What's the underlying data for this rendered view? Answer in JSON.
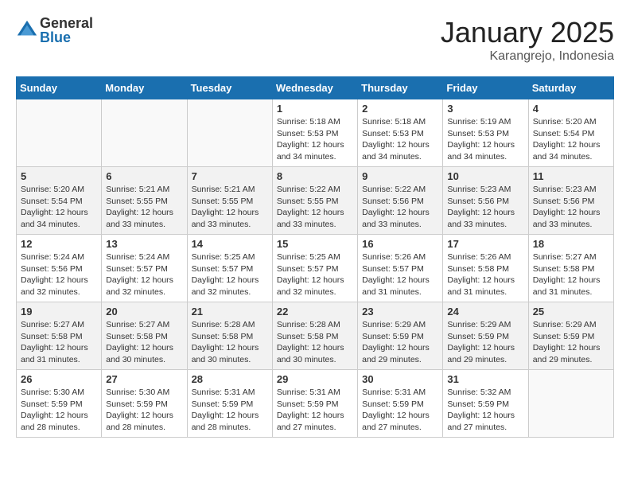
{
  "logo": {
    "general": "General",
    "blue": "Blue"
  },
  "title": "January 2025",
  "location": "Karangrejo, Indonesia",
  "weekdays": [
    "Sunday",
    "Monday",
    "Tuesday",
    "Wednesday",
    "Thursday",
    "Friday",
    "Saturday"
  ],
  "weeks": [
    [
      {
        "day": "",
        "info": ""
      },
      {
        "day": "",
        "info": ""
      },
      {
        "day": "",
        "info": ""
      },
      {
        "day": "1",
        "info": "Sunrise: 5:18 AM\nSunset: 5:53 PM\nDaylight: 12 hours\nand 34 minutes."
      },
      {
        "day": "2",
        "info": "Sunrise: 5:18 AM\nSunset: 5:53 PM\nDaylight: 12 hours\nand 34 minutes."
      },
      {
        "day": "3",
        "info": "Sunrise: 5:19 AM\nSunset: 5:53 PM\nDaylight: 12 hours\nand 34 minutes."
      },
      {
        "day": "4",
        "info": "Sunrise: 5:20 AM\nSunset: 5:54 PM\nDaylight: 12 hours\nand 34 minutes."
      }
    ],
    [
      {
        "day": "5",
        "info": "Sunrise: 5:20 AM\nSunset: 5:54 PM\nDaylight: 12 hours\nand 34 minutes."
      },
      {
        "day": "6",
        "info": "Sunrise: 5:21 AM\nSunset: 5:55 PM\nDaylight: 12 hours\nand 33 minutes."
      },
      {
        "day": "7",
        "info": "Sunrise: 5:21 AM\nSunset: 5:55 PM\nDaylight: 12 hours\nand 33 minutes."
      },
      {
        "day": "8",
        "info": "Sunrise: 5:22 AM\nSunset: 5:55 PM\nDaylight: 12 hours\nand 33 minutes."
      },
      {
        "day": "9",
        "info": "Sunrise: 5:22 AM\nSunset: 5:56 PM\nDaylight: 12 hours\nand 33 minutes."
      },
      {
        "day": "10",
        "info": "Sunrise: 5:23 AM\nSunset: 5:56 PM\nDaylight: 12 hours\nand 33 minutes."
      },
      {
        "day": "11",
        "info": "Sunrise: 5:23 AM\nSunset: 5:56 PM\nDaylight: 12 hours\nand 33 minutes."
      }
    ],
    [
      {
        "day": "12",
        "info": "Sunrise: 5:24 AM\nSunset: 5:56 PM\nDaylight: 12 hours\nand 32 minutes."
      },
      {
        "day": "13",
        "info": "Sunrise: 5:24 AM\nSunset: 5:57 PM\nDaylight: 12 hours\nand 32 minutes."
      },
      {
        "day": "14",
        "info": "Sunrise: 5:25 AM\nSunset: 5:57 PM\nDaylight: 12 hours\nand 32 minutes."
      },
      {
        "day": "15",
        "info": "Sunrise: 5:25 AM\nSunset: 5:57 PM\nDaylight: 12 hours\nand 32 minutes."
      },
      {
        "day": "16",
        "info": "Sunrise: 5:26 AM\nSunset: 5:57 PM\nDaylight: 12 hours\nand 31 minutes."
      },
      {
        "day": "17",
        "info": "Sunrise: 5:26 AM\nSunset: 5:58 PM\nDaylight: 12 hours\nand 31 minutes."
      },
      {
        "day": "18",
        "info": "Sunrise: 5:27 AM\nSunset: 5:58 PM\nDaylight: 12 hours\nand 31 minutes."
      }
    ],
    [
      {
        "day": "19",
        "info": "Sunrise: 5:27 AM\nSunset: 5:58 PM\nDaylight: 12 hours\nand 31 minutes."
      },
      {
        "day": "20",
        "info": "Sunrise: 5:27 AM\nSunset: 5:58 PM\nDaylight: 12 hours\nand 30 minutes."
      },
      {
        "day": "21",
        "info": "Sunrise: 5:28 AM\nSunset: 5:58 PM\nDaylight: 12 hours\nand 30 minutes."
      },
      {
        "day": "22",
        "info": "Sunrise: 5:28 AM\nSunset: 5:58 PM\nDaylight: 12 hours\nand 30 minutes."
      },
      {
        "day": "23",
        "info": "Sunrise: 5:29 AM\nSunset: 5:59 PM\nDaylight: 12 hours\nand 29 minutes."
      },
      {
        "day": "24",
        "info": "Sunrise: 5:29 AM\nSunset: 5:59 PM\nDaylight: 12 hours\nand 29 minutes."
      },
      {
        "day": "25",
        "info": "Sunrise: 5:29 AM\nSunset: 5:59 PM\nDaylight: 12 hours\nand 29 minutes."
      }
    ],
    [
      {
        "day": "26",
        "info": "Sunrise: 5:30 AM\nSunset: 5:59 PM\nDaylight: 12 hours\nand 28 minutes."
      },
      {
        "day": "27",
        "info": "Sunrise: 5:30 AM\nSunset: 5:59 PM\nDaylight: 12 hours\nand 28 minutes."
      },
      {
        "day": "28",
        "info": "Sunrise: 5:31 AM\nSunset: 5:59 PM\nDaylight: 12 hours\nand 28 minutes."
      },
      {
        "day": "29",
        "info": "Sunrise: 5:31 AM\nSunset: 5:59 PM\nDaylight: 12 hours\nand 27 minutes."
      },
      {
        "day": "30",
        "info": "Sunrise: 5:31 AM\nSunset: 5:59 PM\nDaylight: 12 hours\nand 27 minutes."
      },
      {
        "day": "31",
        "info": "Sunrise: 5:32 AM\nSunset: 5:59 PM\nDaylight: 12 hours\nand 27 minutes."
      },
      {
        "day": "",
        "info": ""
      }
    ]
  ]
}
